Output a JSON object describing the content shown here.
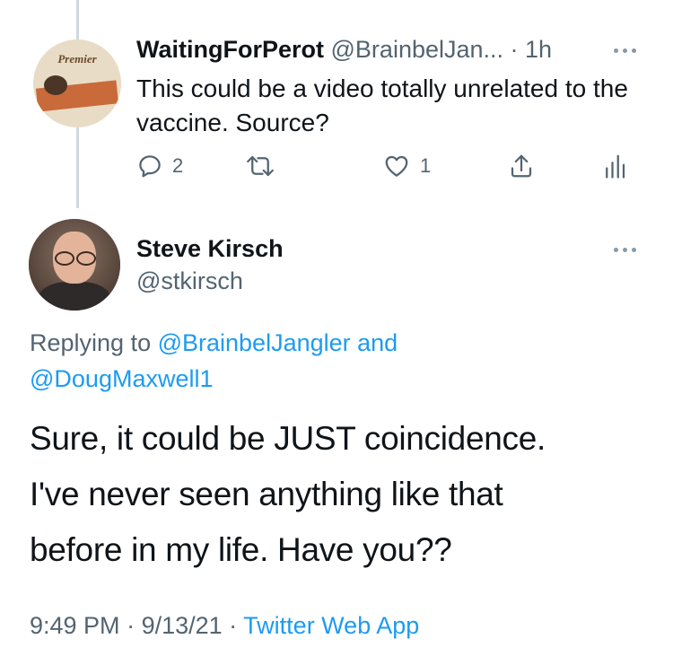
{
  "reply_tweet": {
    "avatar_text": "Premier",
    "display_name": "WaitingForPerot",
    "handle": "@BrainbelJan...",
    "separator": " · ",
    "time": "1h",
    "text": "This could be a video totally unrelated to the vaccine. Source?",
    "actions": {
      "reply_count": "2",
      "retweet_count": "",
      "like_count": "1"
    }
  },
  "main_tweet": {
    "display_name": "Steve Kirsch",
    "handle": "@stkirsch",
    "replying_prefix": "Replying to ",
    "mention_1": "@BrainbelJangler",
    "replying_and": " and",
    "mention_2": "@DougMaxwell1",
    "text_line_1": "Sure, it could be JUST coincidence.",
    "text_line_2": "I've never seen anything like that",
    "text_line_3": "before in my life. Have you??",
    "time": "9:49 PM",
    "date": "9/13/21",
    "dot": " · ",
    "source_app": "Twitter Web App"
  },
  "colors": {
    "accent": "#1d9bf0",
    "secondary_text": "#536471",
    "primary_text": "#0f1419",
    "thread_line": "#cfd9de"
  },
  "icons": [
    "reply-icon",
    "retweet-icon",
    "like-icon",
    "share-icon",
    "analytics-icon",
    "more-icon"
  ]
}
